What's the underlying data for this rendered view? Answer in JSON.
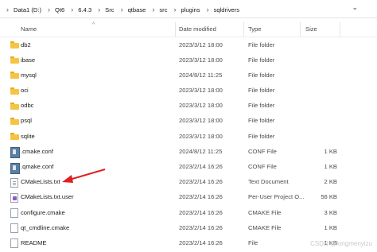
{
  "breadcrumb": [
    "Data1 (D:)",
    "Qt6",
    "6.4.3",
    "Src",
    "qtbase",
    "src",
    "plugins",
    "sqldrivers"
  ],
  "columns": {
    "name": "Name",
    "date": "Date modified",
    "type": "Type",
    "size": "Size"
  },
  "rows": [
    {
      "name": "db2",
      "date": "2023/3/12 18:00",
      "type": "File folder",
      "size": "",
      "icon": "folder-icon"
    },
    {
      "name": "ibase",
      "date": "2023/3/12 18:00",
      "type": "File folder",
      "size": "",
      "icon": "folder-icon"
    },
    {
      "name": "mysql",
      "date": "2024/8/12 11:25",
      "type": "File folder",
      "size": "",
      "icon": "folder-icon"
    },
    {
      "name": "oci",
      "date": "2023/3/12 18:00",
      "type": "File folder",
      "size": "",
      "icon": "folder-icon"
    },
    {
      "name": "odbc",
      "date": "2023/3/12 18:00",
      "type": "File folder",
      "size": "",
      "icon": "folder-icon"
    },
    {
      "name": "psql",
      "date": "2023/3/12 18:00",
      "type": "File folder",
      "size": "",
      "icon": "folder-icon"
    },
    {
      "name": "sqlite",
      "date": "2023/3/12 18:00",
      "type": "File folder",
      "size": "",
      "icon": "folder-icon"
    },
    {
      "name": ".cmake.conf",
      "date": "2024/8/12 11:25",
      "type": "CONF File",
      "size": "1 KB",
      "icon": "conf-file-icon"
    },
    {
      "name": ".qmake.conf",
      "date": "2023/2/14 16:26",
      "type": "CONF File",
      "size": "1 KB",
      "icon": "conf-file-icon"
    },
    {
      "name": "CMakeLists.txt",
      "date": "2023/2/14 16:26",
      "type": "Text Document",
      "size": "2 KB",
      "icon": "text-file-icon"
    },
    {
      "name": "CMakeLists.txt.user",
      "date": "2023/2/14 16:26",
      "type": "Per-User Project O...",
      "size": "56 KB",
      "icon": "user-file-icon"
    },
    {
      "name": "configure.cmake",
      "date": "2023/2/14 16:26",
      "type": "CMAKE File",
      "size": "3 KB",
      "icon": "file-icon"
    },
    {
      "name": "qt_cmdline.cmake",
      "date": "2023/2/14 16:26",
      "type": "CMAKE File",
      "size": "1 KB",
      "icon": "file-icon"
    },
    {
      "name": "README",
      "date": "2023/2/14 16:26",
      "type": "File",
      "size": "1 KB",
      "icon": "file-icon"
    }
  ],
  "annotation": {
    "color": "#e02020"
  },
  "watermark": "CSDN @longmenyizu"
}
